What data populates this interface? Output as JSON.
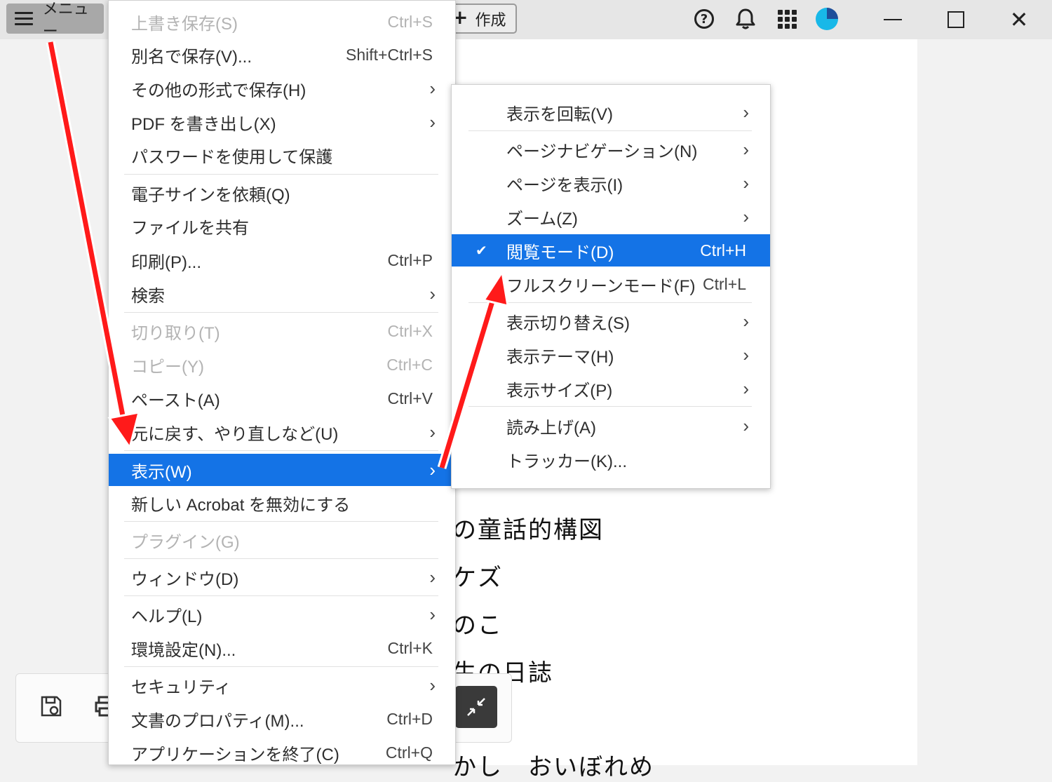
{
  "topbar": {
    "menu_label": "メニュー",
    "create_label": "作成",
    "help_glyph": "?",
    "close_glyph": "✕",
    "avatar_colors": [
      "#1f4f9a",
      "#18b8e8"
    ]
  },
  "document": {
    "lines": [
      "の童話的構図",
      "ケズ",
      "のこ",
      "生の日誌",
      "かし　おいぼれめ"
    ]
  },
  "main_menu": {
    "items": [
      {
        "label": "上書き保存(S)",
        "shortcut": "Ctrl+S",
        "disabled": true
      },
      {
        "label": "別名で保存(V)...",
        "shortcut": "Shift+Ctrl+S"
      },
      {
        "label": "その他の形式で保存(H)",
        "submenu": true
      },
      {
        "label": "PDF を書き出し(X)",
        "submenu": true
      },
      {
        "label": "パスワードを使用して保護"
      },
      {
        "label": "電子サインを依頼(Q)"
      },
      {
        "label": "ファイルを共有"
      },
      {
        "label": "印刷(P)...",
        "shortcut": "Ctrl+P"
      },
      {
        "label": "検索",
        "submenu": true
      },
      {
        "label": "切り取り(T)",
        "shortcut": "Ctrl+X",
        "disabled": true
      },
      {
        "label": "コピー(Y)",
        "shortcut": "Ctrl+C",
        "disabled": true
      },
      {
        "label": "ペースト(A)",
        "shortcut": "Ctrl+V"
      },
      {
        "label": "元に戻す、やり直しなど(U)",
        "submenu": true
      },
      {
        "label": "表示(W)",
        "submenu": true,
        "highlight": true
      },
      {
        "label": "新しい Acrobat を無効にする"
      },
      {
        "label": "プラグイン(G)",
        "disabled": true
      },
      {
        "label": "ウィンドウ(D)",
        "submenu": true
      },
      {
        "label": "ヘルプ(L)",
        "submenu": true
      },
      {
        "label": "環境設定(N)...",
        "shortcut": "Ctrl+K"
      },
      {
        "label": "セキュリティ",
        "submenu": true
      },
      {
        "label": "文書のプロパティ(M)...",
        "shortcut": "Ctrl+D"
      },
      {
        "label": "アプリケーションを終了(C)",
        "shortcut": "Ctrl+Q"
      }
    ]
  },
  "view_submenu": {
    "items": [
      {
        "label": "表示を回転(V)",
        "submenu": true
      },
      {
        "label": "ページナビゲーション(N)",
        "submenu": true
      },
      {
        "label": "ページを表示(I)",
        "submenu": true
      },
      {
        "label": "ズーム(Z)",
        "submenu": true
      },
      {
        "label": "閲覧モード(D)",
        "shortcut": "Ctrl+H",
        "checked": true,
        "highlight": true
      },
      {
        "label": "フルスクリーンモード(F)",
        "shortcut": "Ctrl+L"
      },
      {
        "label": "表示切り替え(S)",
        "submenu": true
      },
      {
        "label": "表示テーマ(H)",
        "submenu": true
      },
      {
        "label": "表示サイズ(P)",
        "submenu": true
      },
      {
        "label": "読み上げ(A)",
        "submenu": true
      },
      {
        "label": "トラッカー(K)..."
      }
    ]
  },
  "glyphs": {
    "chevron": "›",
    "check": "✔"
  },
  "colors": {
    "highlight": "#1473e6",
    "arrow": "#ff1a1a"
  }
}
